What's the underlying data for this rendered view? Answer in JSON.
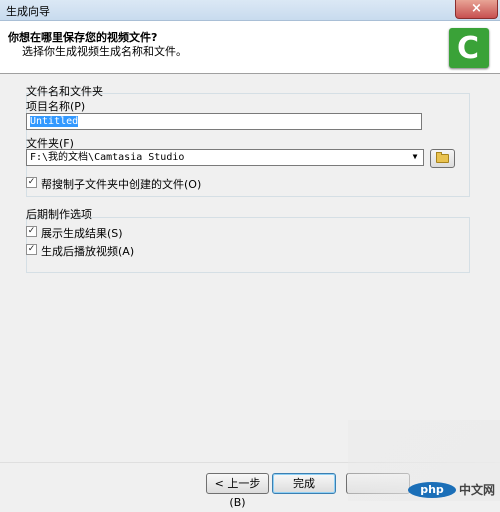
{
  "window": {
    "title": "生成向导",
    "close_glyph": "×"
  },
  "header": {
    "title": "你想在哪里保存您的视频文件?",
    "subtitle": "选择你生成视频生成名称和文件。",
    "logo_letter": "C"
  },
  "file_section": {
    "label": "文件名和文件夹",
    "project_name_label": "项目名称(P)",
    "project_name_value": "Untitled",
    "folder_label": "文件夹(F)",
    "folder_value": "F:\\我的文档\\Camtasia Studio",
    "subfolder_checkbox": {
      "label": "帮搜制子文件夹中创建的文件(O)",
      "checked": true
    }
  },
  "post_section": {
    "label": "后期制作选项",
    "show_results": {
      "label": "展示生成结果(S)",
      "checked": true
    },
    "play_after": {
      "label": "生成后播放视频(A)",
      "checked": true
    }
  },
  "buttons": {
    "back": "< 上一步(B)",
    "finish": "完成"
  },
  "watermark": {
    "logo": "php",
    "text": "中文网"
  }
}
